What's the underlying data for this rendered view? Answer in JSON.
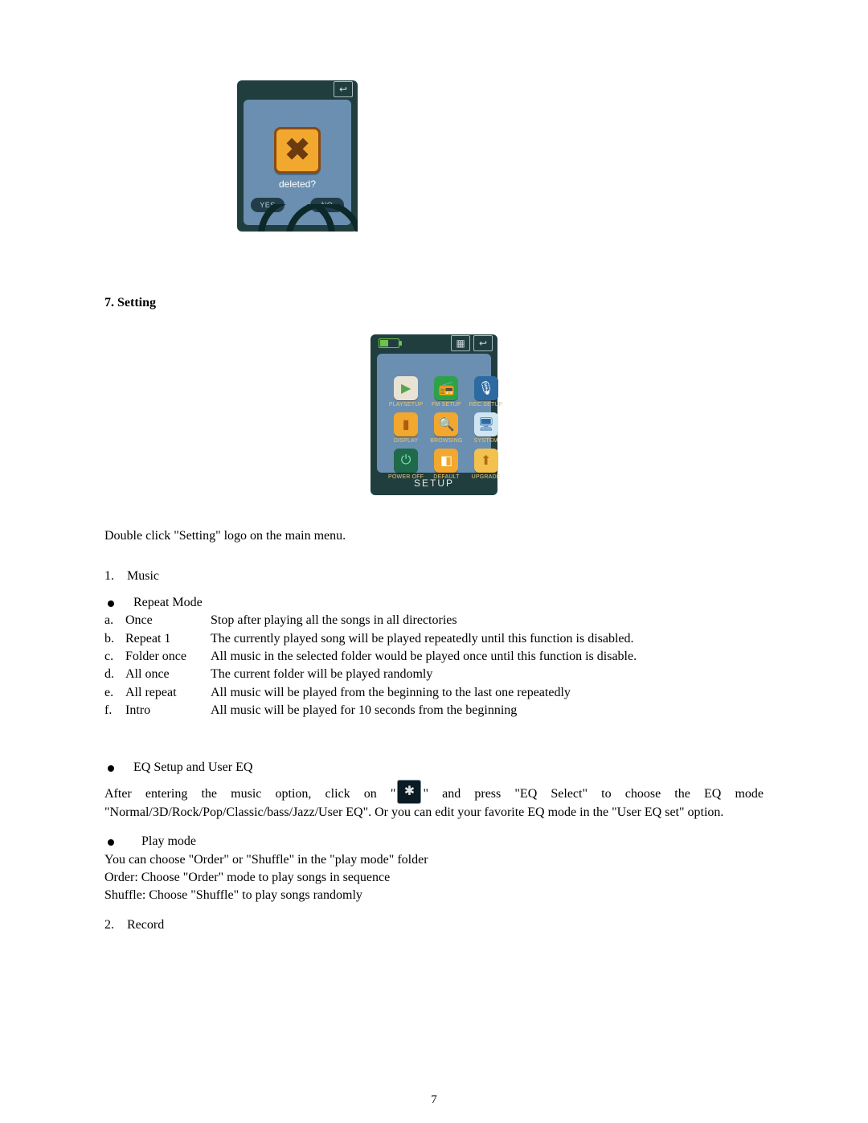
{
  "device1": {
    "back_icon_label": "back-arrow-icon",
    "deleted_label": "deleted?",
    "yes_label": "YES",
    "no_label": "NO"
  },
  "device2": {
    "cells": [
      {
        "label": "PLAYSETUP",
        "bg": "#e9e3d6",
        "glyph": "▶",
        "fg": "#5aa54a"
      },
      {
        "label": "FM SETUP",
        "bg": "#2ea24a",
        "glyph": "📻",
        "fg": "#fff"
      },
      {
        "label": "REC.SETUP",
        "bg": "#2e6aa2",
        "glyph": "🎙",
        "fg": "#fff"
      },
      {
        "label": "DISPLAY",
        "bg": "#f2a72e",
        "glyph": "▮",
        "fg": "#b15a15"
      },
      {
        "label": "BROWSING",
        "bg": "#f2a72e",
        "glyph": "🔍",
        "fg": "#fff"
      },
      {
        "label": "SYSTEM",
        "bg": "#cfe6f2",
        "glyph": "🖥",
        "fg": "#2e6aa2"
      },
      {
        "label": "POWER OFF",
        "bg": "#1e6a4a",
        "glyph": "⏻",
        "fg": "#7ee0b0"
      },
      {
        "label": "DEFAULT",
        "bg": "#f2a72e",
        "glyph": "◧",
        "fg": "#fff"
      },
      {
        "label": "UPGRADE",
        "bg": "#f2c14e",
        "glyph": "⬆",
        "fg": "#b06a15"
      }
    ],
    "footer": "SETUP"
  },
  "section": {
    "heading": "7. Setting"
  },
  "intro": "Double click \"Setting\" logo on the main menu.",
  "list1": {
    "num": "1.",
    "label": "Music"
  },
  "bullets": {
    "repeat_mode": "Repeat Mode",
    "eq_setup": "EQ Setup and User EQ",
    "play_mode": "Play mode"
  },
  "repeat_rows": [
    {
      "mark": "a.",
      "name": "Once",
      "desc": "Stop after playing all the songs in all directories"
    },
    {
      "mark": "b.",
      "name": "Repeat 1",
      "desc": "The currently played song will be played repeatedly until this function is disabled."
    },
    {
      "mark": "c.",
      "name": "Folder once",
      "desc": "All music in the selected folder would be played once until this function is disable."
    },
    {
      "mark": "d.",
      "name": "All once",
      "desc": "The current folder will be played randomly"
    },
    {
      "mark": "e.",
      "name": "All repeat",
      "desc": "All music will be played from the beginning to the last one repeatedly"
    },
    {
      "mark": "f.",
      "name": "Intro",
      "desc": "All music will be played for 10 seconds from the beginning"
    }
  ],
  "eq_paragraph": {
    "pre": "After entering the music option, click on \"",
    "post": "\" and press \"EQ Select\" to choose the EQ mode \"Normal/3D/Rock/Pop/Classic/bass/Jazz/User EQ\". Or you can edit your favorite EQ mode in the \"User EQ set\" option."
  },
  "playmode_lines": [
    "You can choose \"Order\" or \"Shuffle\" in the \"play mode\" folder",
    "Order: Choose \"Order\" mode to play songs in sequence",
    "Shuffle: Choose \"Shuffle\" to play songs randomly"
  ],
  "list2": {
    "num": "2.",
    "label": "Record"
  },
  "page_number": "7"
}
